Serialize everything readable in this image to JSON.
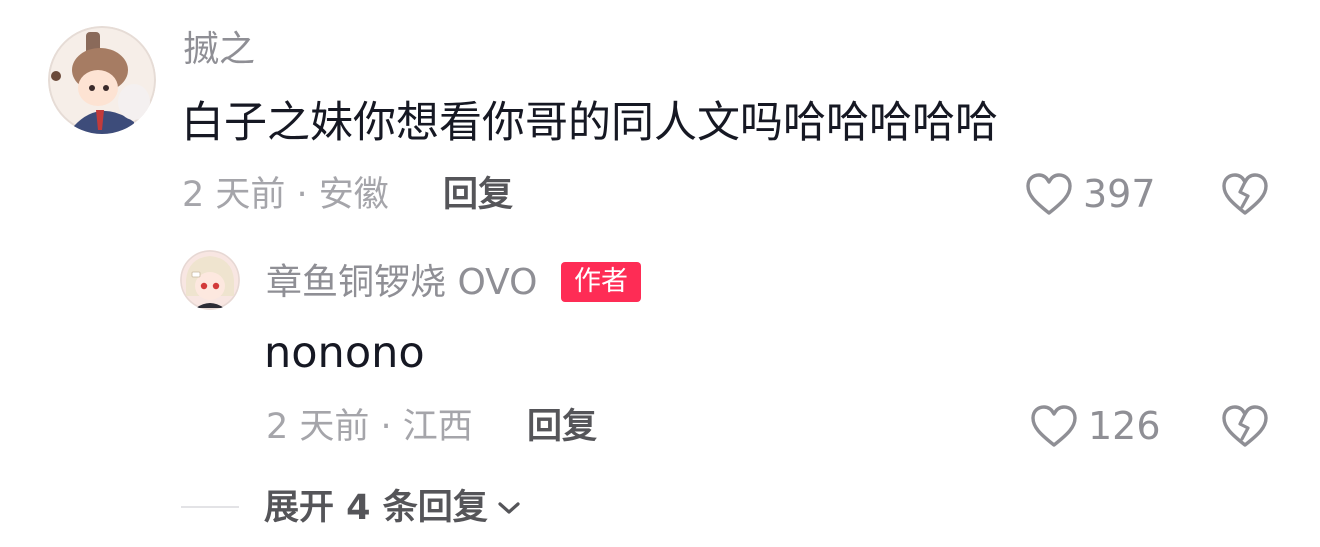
{
  "comment": {
    "username": "揻之",
    "text": "白子之妹你想看你哥的同人文吗哈哈哈哈哈",
    "meta": "2 天前 · 安徽",
    "reply_label": "回复",
    "like_count": "397"
  },
  "reply": {
    "username": "章鱼铜锣烧 OVO",
    "author_badge": "作者",
    "text": "nonono",
    "meta": "2 天前 · 江西",
    "reply_label": "回复",
    "like_count": "126"
  },
  "expand": {
    "label": "展开 4 条回复"
  },
  "colors": {
    "badge": "#fe2c55",
    "text_primary": "#161823",
    "text_secondary": "#8f8f95"
  }
}
